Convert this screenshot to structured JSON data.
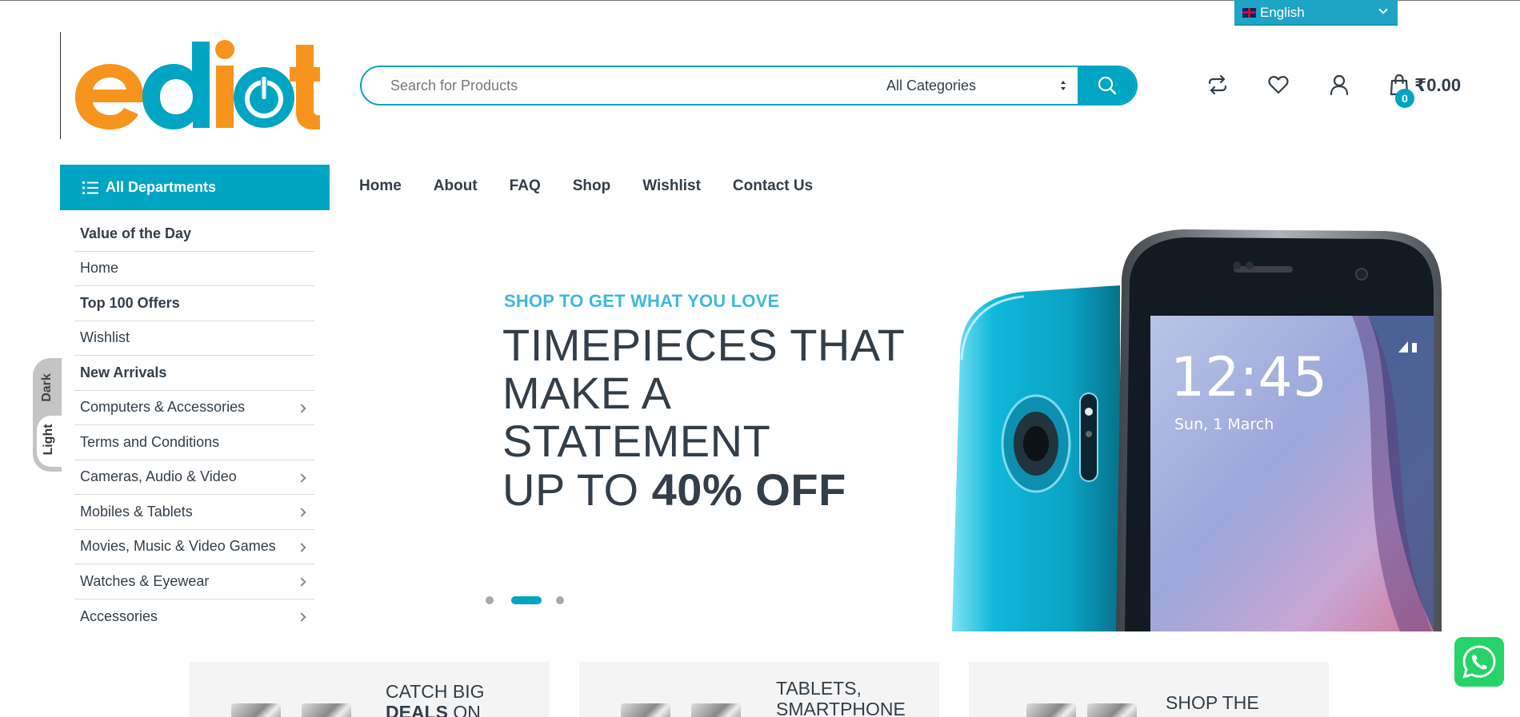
{
  "language": {
    "selected": "English"
  },
  "search": {
    "placeholder": "Search for Products",
    "category": "All Categories"
  },
  "header": {
    "cart_total": "₹0.00",
    "cart_count": "0"
  },
  "departments": {
    "button_label": "All Departments",
    "items": [
      {
        "label": "Value of the Day",
        "bold": true,
        "submenu": false
      },
      {
        "label": "Home",
        "bold": false,
        "submenu": false
      },
      {
        "label": "Top 100 Offers",
        "bold": true,
        "submenu": false
      },
      {
        "label": "Wishlist",
        "bold": false,
        "submenu": false
      },
      {
        "label": "New Arrivals",
        "bold": true,
        "submenu": false
      },
      {
        "label": "Computers & Accessories",
        "bold": false,
        "submenu": true
      },
      {
        "label": "Terms and Conditions",
        "bold": false,
        "submenu": false
      },
      {
        "label": "Cameras, Audio & Video",
        "bold": false,
        "submenu": true
      },
      {
        "label": "Mobiles & Tablets",
        "bold": false,
        "submenu": true
      },
      {
        "label": "Movies, Music & Video Games",
        "bold": false,
        "submenu": true
      },
      {
        "label": "Watches & Eyewear",
        "bold": false,
        "submenu": true
      },
      {
        "label": "Accessories",
        "bold": false,
        "submenu": true
      }
    ]
  },
  "nav": [
    "Home",
    "About",
    "FAQ",
    "Shop",
    "Wishlist",
    "Contact Us"
  ],
  "theme_toggle": {
    "dark": "Dark",
    "light": "Light"
  },
  "hero": {
    "eyebrow": "SHOP TO GET WHAT YOU LOVE",
    "title_lines": [
      "TIMEPIECES THAT",
      "MAKE A",
      "STATEMENT"
    ],
    "offer_prefix": "UP TO",
    "offer_value": "40% OFF",
    "phone_time": "12:45",
    "phone_date": "Sun, 1 March",
    "active_slide": 2,
    "slide_count": 3
  },
  "promos": [
    {
      "line1": "CATCH BIG",
      "line2_bold": "DEALS",
      "line2_rest": "ON"
    },
    {
      "line1": "TABLETS,",
      "line2_bold": "",
      "line2_rest": "SMARTPHONE"
    },
    {
      "line1": "SHOP THE",
      "line2_bold": "",
      "line2_rest": ""
    }
  ],
  "colors": {
    "accent": "#00a5c4",
    "logo_orange": "#f7941d",
    "logo_cyan": "#00a5c4",
    "text": "#333e48",
    "whatsapp": "#25d366"
  },
  "icons": [
    "compare-icon",
    "heart-icon",
    "user-icon",
    "shopping-bag-icon",
    "search-icon",
    "list-icon",
    "whatsapp-icon"
  ]
}
